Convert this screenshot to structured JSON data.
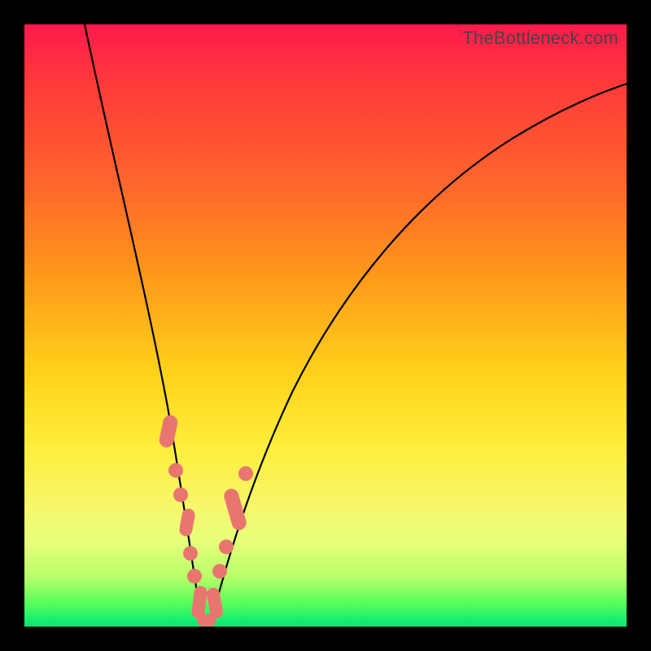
{
  "watermark": "TheBottleneck.com",
  "colors": {
    "frame": "#000000",
    "gradient_top": "#ff1a4d",
    "gradient_mid1": "#ff9a1a",
    "gradient_mid2": "#ffee3a",
    "gradient_bottom": "#00e676",
    "curve": "#000000",
    "marker": "#e8766f"
  },
  "chart_data": {
    "type": "line",
    "title": "",
    "xlabel": "",
    "ylabel": "",
    "xlim": [
      0,
      100
    ],
    "ylim": [
      0,
      100
    ],
    "grid": false,
    "legend": false,
    "notes": "Two-branch V-shaped bottleneck curve on red-to-green gradient background. Y decreases (better) toward bottom. Salmon markers highlight a band of near-optimal points on each branch near the bottom.",
    "series": [
      {
        "name": "left_branch",
        "x": [
          10,
          13,
          16,
          19,
          21,
          23,
          24.5,
          26,
          27,
          27.8,
          28.4,
          28.8,
          29.2,
          29.5
        ],
        "y": [
          100,
          85,
          70,
          56,
          46,
          37,
          30,
          23,
          17,
          12,
          8,
          5,
          2.5,
          1
        ]
      },
      {
        "name": "right_branch",
        "x": [
          30.5,
          31,
          32,
          33.5,
          35.5,
          38,
          42,
          47,
          53,
          60,
          68,
          77,
          87,
          98
        ],
        "y": [
          1,
          2.5,
          5.5,
          10,
          16,
          23,
          32,
          42,
          52,
          61,
          69,
          76,
          82,
          87
        ]
      }
    ],
    "highlight_markers": {
      "left": {
        "x": [
          23.5,
          25.2,
          26.2,
          27.0,
          27.7,
          28.3,
          28.8,
          29.3
        ],
        "y": [
          33,
          25,
          20,
          15,
          11,
          7.5,
          4.5,
          2
        ]
      },
      "right": {
        "x": [
          30.7,
          31.4,
          32.3,
          33.3,
          34.5,
          35.8
        ],
        "y": [
          2,
          4.5,
          8,
          12,
          17,
          22
        ]
      }
    }
  }
}
